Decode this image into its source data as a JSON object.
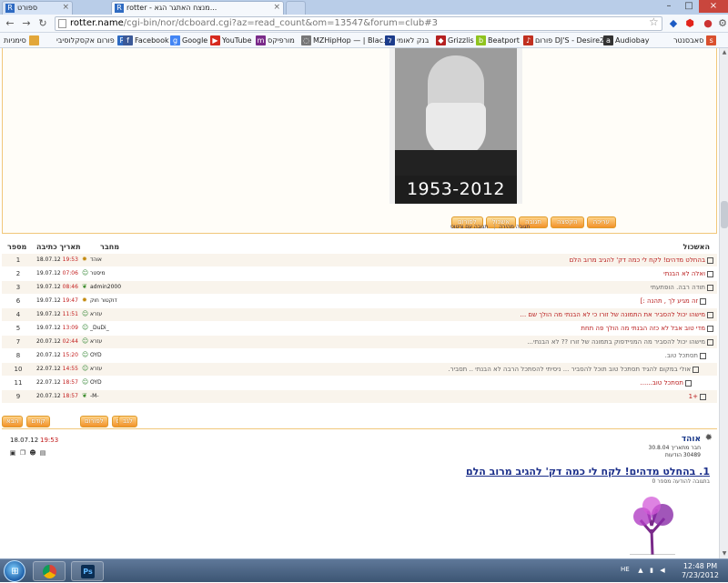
{
  "browser": {
    "tabs": [
      {
        "title": "ספורט",
        "favicon": "R",
        "active": false
      },
      {
        "title": "rotter - מנצח האתגר הגא...",
        "favicon": "R",
        "active": true
      }
    ],
    "url_host": "rotter.name",
    "url_path": "/cgi-bin/nor/dcboard.cgi?az=read_count&om=13547&forum=club#3",
    "bookmarks": [
      {
        "label": "סימניות",
        "icon": "folder-icon",
        "color": "#e2a73a"
      },
      {
        "label": "פורום אקסקלוסיבי",
        "icon": "r-icon",
        "color": "#2f6bc2"
      },
      {
        "label": "Facebook",
        "icon": "f-icon",
        "color": "#3b5998"
      },
      {
        "label": "Google",
        "icon": "g-icon",
        "color": "#4285f4"
      },
      {
        "label": "YouTube",
        "icon": "youtube-icon",
        "color": "#d62a1f"
      },
      {
        "label": "מורפיקס",
        "icon": "m-icon",
        "color": "#7a2b8a"
      },
      {
        "label": "MZHipHop — | Blac...",
        "icon": "globe-icon",
        "color": "#777"
      },
      {
        "label": "בנק לאומי",
        "icon": "leumi-icon",
        "color": "#1c3c8c"
      },
      {
        "label": "Grizzlis",
        "icon": "bear-icon",
        "color": "#b52020"
      },
      {
        "label": "Beatport",
        "icon": "beatport-icon",
        "color": "#8fc31f"
      },
      {
        "label": "פורום DJ'S - Desire2...",
        "icon": "music-icon",
        "color": "#c13020"
      },
      {
        "label": "Audiobay",
        "icon": "audiobay-icon",
        "color": "#333"
      },
      {
        "label": "סאבסנטר",
        "icon": "subcenter-icon",
        "color": "#d9502e"
      }
    ]
  },
  "photo": {
    "years": "1953-2012"
  },
  "top_buttons": [
    {
      "label": "לפורום",
      "variant": "plain"
    },
    {
      "label": "אשכול",
      "variant": "plain"
    },
    {
      "label": "תגובה",
      "variant": "orange"
    },
    {
      "label": "הקפצה",
      "variant": "orange"
    },
    {
      "label": "עריכה",
      "variant": "orange"
    }
  ],
  "small_links": [
    "תגובה עם ציטוט",
    "תגובה מהירה"
  ],
  "table": {
    "headers": {
      "thread": "האשכול",
      "author": "מחבר",
      "date": "תאריך כתיבה",
      "number": "מספר"
    },
    "rows": [
      {
        "num": "1",
        "date": "18.07.12",
        "time": "19:53",
        "author": "אוהד",
        "author_icon": "sun",
        "title": "בהחלט מדהים! לקח לי כמה דק' להגיב מרוב הלם",
        "indent": 0,
        "red": true
      },
      {
        "num": "2",
        "date": "19.07.12",
        "time": "07:06",
        "author": "מיסטר",
        "author_icon": "person",
        "title": "ואלה לא הבנתי",
        "indent": 0,
        "red": true
      },
      {
        "num": "3",
        "date": "19.07.12",
        "time": "08:46",
        "author": "admin2000",
        "author_icon": "leaf",
        "title": "תודה רבה. הופתעתי",
        "indent": 0,
        "red": false
      },
      {
        "num": "6",
        "date": "19.07.12",
        "time": "19:47",
        "author": "דוקטור חוק",
        "author_icon": "sun",
        "title": "זה מגיע לך , תהנה :]",
        "indent": 1,
        "red": true
      },
      {
        "num": "4",
        "date": "19.07.12",
        "time": "11:51",
        "author": "עזרא",
        "author_icon": "person",
        "title": "מישהו יכול להסביר את התמונה של זורו כי לא הבנתי מה הולך שם ...",
        "indent": 0,
        "red": true
      },
      {
        "num": "5",
        "date": "19.07.12",
        "time": "13:09",
        "author": "_DuDi_",
        "author_icon": "person",
        "title": "מדי טוב אבל לא כזה הבנתי מה הולך פה תחת",
        "indent": 0,
        "red": true
      },
      {
        "num": "7",
        "date": "20.07.12",
        "time": "02:44",
        "author": "עזרא",
        "author_icon": "person",
        "title": "מישהו יכול להסביר מה המניידפוק בתמונה של זורו ?? לא הבנתי...",
        "indent": 0,
        "red": false
      },
      {
        "num": "8",
        "date": "20.07.12",
        "time": "15:20",
        "author": "OYD",
        "author_icon": "person",
        "title": "תסתכל טוב.",
        "indent": 1,
        "red": false
      },
      {
        "num": "10",
        "date": "22.07.12",
        "time": "14:55",
        "author": "עזרא",
        "author_icon": "person",
        "title": "אולי במקום להגיד תסתכל טוב תוכל להסביר ... ניסיתי להסתכל הרבה לא הבנתי .. תסביר.",
        "indent": 2,
        "red": false
      },
      {
        "num": "11",
        "date": "22.07.12",
        "time": "18:57",
        "author": "OYD",
        "author_icon": "person",
        "title": "תסתכל טוב......",
        "indent": 3,
        "red": true
      },
      {
        "num": "9",
        "date": "20.07.12",
        "time": "18:57",
        "author": "-M-",
        "author_icon": "leaf",
        "title": "+1",
        "indent": 1,
        "red": true
      }
    ]
  },
  "bottom_buttons_left": [
    "הבא",
    "קודם",
    "לפורום",
    "לגב"
  ],
  "post": {
    "date": "18.07.12",
    "time": "19:53",
    "author": "אוהד",
    "meta1": "חבר מתאריך 30.8.04",
    "meta2": "30489 הודעות",
    "title": "1. בהחלט מדהים! לקח לי כמה דק' להגיב מרוב הלם",
    "subtitle": "בתגובה להודעה מספר 0"
  },
  "taskbar": {
    "lang": "HE",
    "time": "12:48 PM",
    "date": "7/23/2012"
  },
  "colors": {
    "accent_orange": "#f2922a",
    "title_red": "#b81b1b",
    "date_red": "#c21c1c",
    "link_blue": "#1b2f8a"
  }
}
